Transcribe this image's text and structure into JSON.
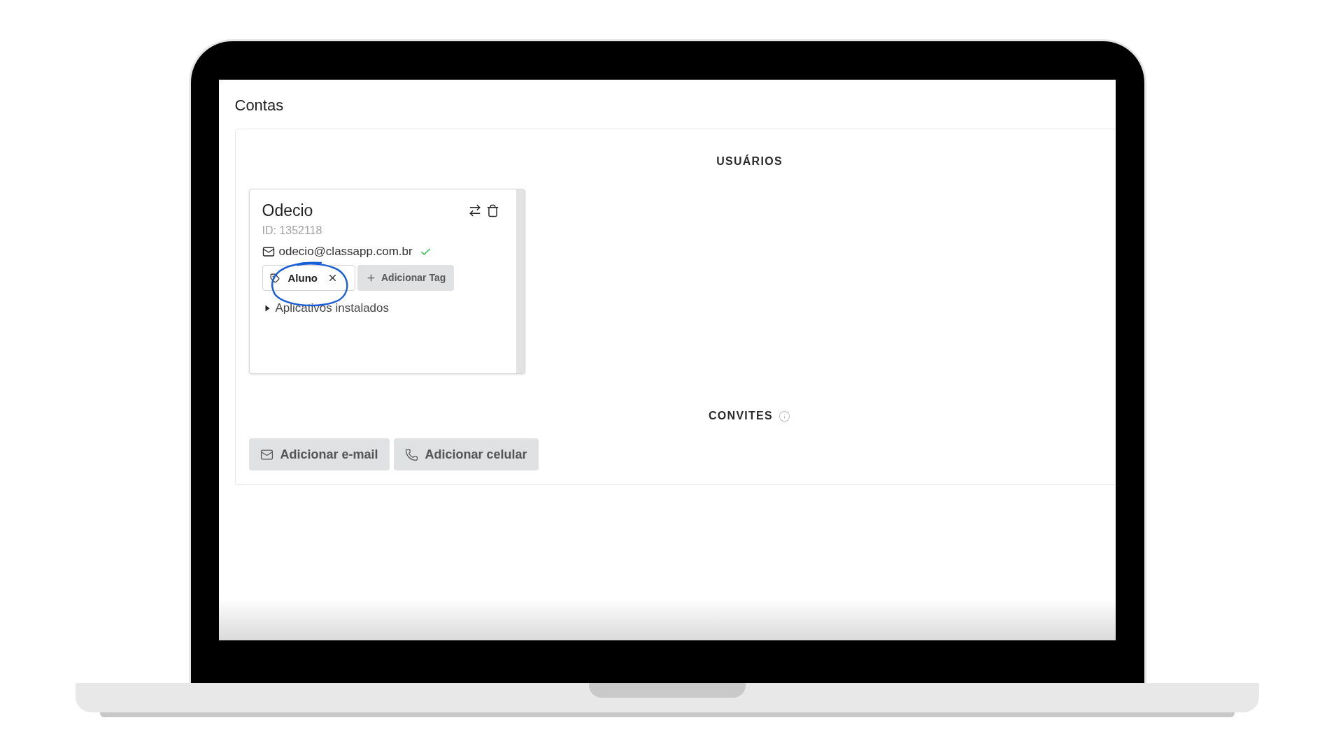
{
  "page": {
    "title": "Contas"
  },
  "users_section": {
    "heading": "USUÁRIOS",
    "users": [
      {
        "name": "Odecio",
        "id_label": "ID: 1352118",
        "email": "odecio@classapp.com.br",
        "email_verified": true,
        "tags": [
          {
            "label": "Aluno"
          }
        ],
        "add_tag_button": "Adicionar Tag",
        "installed_apps": {
          "label": "Aplicativos instalados",
          "expanded": false
        }
      }
    ]
  },
  "invites_section": {
    "heading": "CONVITES",
    "buttons": [
      {
        "kind": "email",
        "label": "Adicionar e-mail"
      },
      {
        "kind": "phone",
        "label": "Adicionar celular"
      }
    ]
  }
}
